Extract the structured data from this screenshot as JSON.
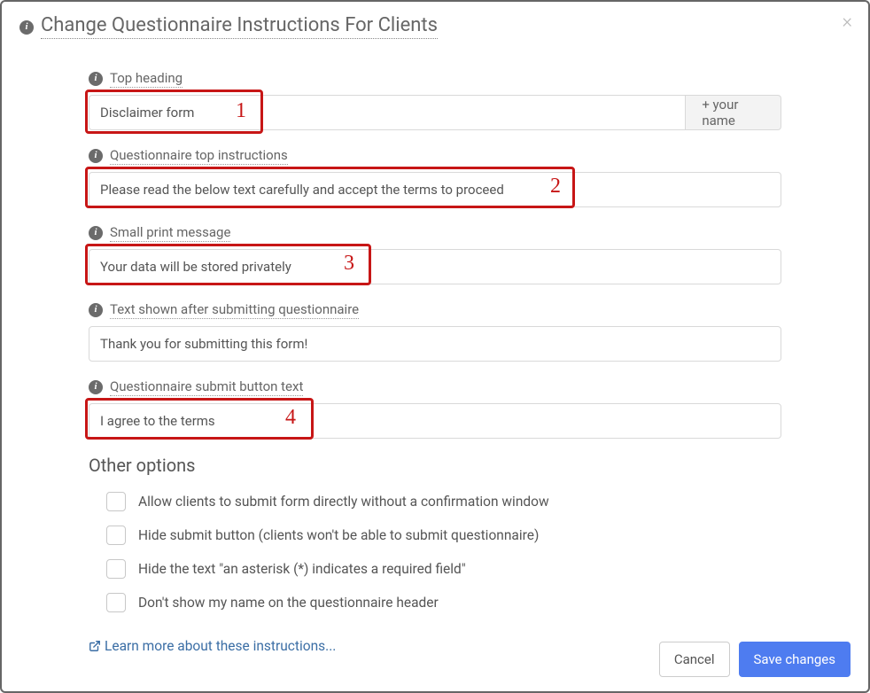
{
  "modal": {
    "title": "Change Questionnaire Instructions For Clients"
  },
  "fields": {
    "top_heading": {
      "label": "Top heading",
      "value": "Disclaimer form",
      "addon": "+ your name"
    },
    "top_instructions": {
      "label": "Questionnaire top instructions",
      "value": "Please read the below text carefully and accept the terms to proceed"
    },
    "small_print": {
      "label": "Small print message",
      "value": "Your data will be stored privately"
    },
    "after_submit": {
      "label": "Text shown after submitting questionnaire",
      "value": "Thank you for submitting this form!"
    },
    "submit_btn_text": {
      "label": "Questionnaire submit button text",
      "value": "I agree to the terms"
    }
  },
  "options_heading": "Other options",
  "options": [
    "Allow clients to submit form directly without a confirmation window",
    "Hide submit button (clients won't be able to submit questionnaire)",
    "Hide the text \"an asterisk (*) indicates a required field\"",
    "Don't show my name on the questionnaire header"
  ],
  "learn_more": "Learn more about these instructions...",
  "footer": {
    "cancel": "Cancel",
    "save": "Save changes"
  },
  "annotations": {
    "1": "1",
    "2": "2",
    "3": "3",
    "4": "4"
  }
}
